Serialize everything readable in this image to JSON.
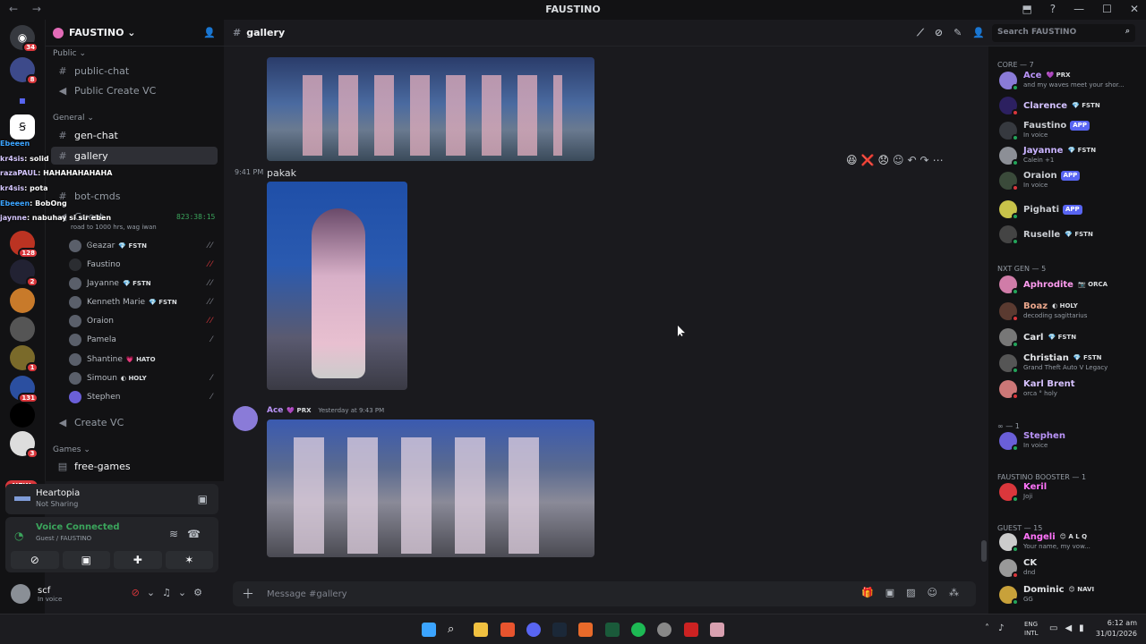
{
  "window": {
    "title": "FAUSTINO",
    "nav": "←  →",
    "controls": [
      "⬒",
      "?",
      "—",
      "☐",
      "✕"
    ]
  },
  "guilds": [
    {
      "badge": "34"
    },
    {
      "badge": "8"
    },
    {
      "badge": ""
    },
    {
      "badge": ""
    },
    {
      "badge": "128"
    },
    {
      "badge": "2"
    },
    {
      "badge": ""
    },
    {
      "badge": ""
    },
    {
      "badge": "1"
    },
    {
      "badge": "131"
    },
    {
      "badge": ""
    },
    {
      "badge": "3"
    }
  ],
  "new_label": "NEW",
  "server": {
    "name": "FAUSTINO ⌄"
  },
  "categories": {
    "public": "Public ⌄",
    "general": "General ⌄",
    "games": "Games ⌄"
  },
  "channels": {
    "public_chat": "public-chat",
    "public_vc": "Public Create VC",
    "gen_chat": "gen-chat",
    "gallery": "gallery",
    "bot_cmds": "bot-cmds",
    "guest": "Guest",
    "guest_status": "road to 1000 hrs, wag iwan",
    "create_vc": "Create VC",
    "free_games": "free-games"
  },
  "voice_timer": "823:38:15",
  "voice_users": [
    {
      "name": "Ꮆeazar",
      "tag": "💎 FSTN"
    },
    {
      "name": "Faustino",
      "tag": ""
    },
    {
      "name": "Jayanne",
      "tag": "💎 FSTN"
    },
    {
      "name": "Kenneth Marie",
      "tag": "💎 FSTN"
    },
    {
      "name": "Oraion",
      "tag": ""
    },
    {
      "name": "Pamela",
      "tag": ""
    },
    {
      "name": "Shantine",
      "tag": "💗 HATO"
    },
    {
      "name": "Simoun",
      "tag": "◐ HOLY"
    },
    {
      "name": "Stephen",
      "tag": ""
    }
  ],
  "overlay_chat": [
    {
      "user": "Ebeeen",
      "text": ""
    },
    {
      "user": "kr4sis",
      "text": ": solid"
    },
    {
      "user": "razaPAUL",
      "text": ": HAHAHAHAHAHA"
    },
    {
      "user": "kr4sis",
      "text": ": pota"
    },
    {
      "user": "Ebeeen",
      "text": ": BobOng"
    },
    {
      "user": "jaynne",
      "text": ": nabuhay si sir eben"
    }
  ],
  "activity": {
    "title": "Heartopia",
    "sub": "Not Sharing"
  },
  "voice": {
    "status": "Voice Connected",
    "channel": "Guest / FAUSTINO"
  },
  "user": {
    "name": "scf",
    "status": "In voice"
  },
  "channel_header": {
    "name": "gallery",
    "search_placeholder": "Search FAUSTINO"
  },
  "messages": [
    {
      "time": "9:41 PM",
      "text": "pakak"
    },
    {
      "author": "Ace",
      "tag": "💜 PRX",
      "timestamp": "Yesterday at 9:43 PM"
    }
  ],
  "reactions": "😆❌😞",
  "composer_placeholder": "Message #gallery",
  "member_groups": [
    {
      "title": "CORE — 7",
      "members": [
        {
          "name": "Ace",
          "tag": "💜 PRX",
          "sub": "and my waves meet your shor...",
          "color": "#b993f7",
          "av": "#8a7bd8"
        },
        {
          "name": "Clarence",
          "tag": "💎 FSTN",
          "sub": "",
          "color": "#d3c1ff",
          "av": "#2c2060"
        },
        {
          "name": "Faustino",
          "tag": "APP",
          "sub": "In voice",
          "color": "#c9ccd1",
          "av": "#36393f"
        },
        {
          "name": "Jayanne",
          "tag": "💎 FSTN",
          "sub": "Calein +1",
          "color": "#c9b3ff",
          "av": "#8c8f96"
        },
        {
          "name": "Oraion",
          "tag": "APP",
          "sub": "In voice",
          "color": "#c9ccd1",
          "av": "#3a4a3a"
        },
        {
          "name": "Pighati",
          "tag": "APP",
          "sub": "",
          "color": "#c9ccd1",
          "av": "#c8c34a"
        },
        {
          "name": "Ruselle",
          "tag": "💎 FSTN",
          "sub": "",
          "color": "#c9ccd1",
          "av": "#444"
        }
      ]
    },
    {
      "title": "NXT GEN — 5",
      "members": [
        {
          "name": "Aphrodite",
          "tag": "📷 ORCA",
          "sub": "",
          "color": "#ff9cf0",
          "av": "#d07ca8"
        },
        {
          "name": "Boaz",
          "tag": "◐ HOLY",
          "sub": "decoding sagittarius",
          "color": "#e9a58a",
          "av": "#5a3a30"
        },
        {
          "name": "Carl",
          "tag": "💎 FSTN",
          "sub": "",
          "color": "#e3e5e8",
          "av": "#777"
        },
        {
          "name": "Christian",
          "tag": "💎 FSTN",
          "sub": "Grand Theft Auto V Legacy",
          "color": "#e3e5e8",
          "av": "#555"
        },
        {
          "name": "Karl Brent",
          "tag": "",
          "sub": "orca ° holy",
          "color": "#d7c2ff",
          "av": "#c77"
        }
      ]
    },
    {
      "title": "∞ — 1",
      "members": [
        {
          "name": "Stephen",
          "tag": "",
          "sub": "In voice",
          "color": "#b993f7",
          "av": "#6a5fd8"
        }
      ]
    },
    {
      "title": "Faustino Booster — 1",
      "members": [
        {
          "name": "Keril",
          "tag": "",
          "sub": "Joji",
          "color": "#ff73fa",
          "av": "#da373c"
        }
      ]
    },
    {
      "title": "Guest — 15",
      "members": [
        {
          "name": "Angeli",
          "tag": "😊 A L Q",
          "sub": "Your name, my vow...",
          "color": "#ff73fa",
          "av": "#ccc"
        },
        {
          "name": "CK",
          "tag": "",
          "sub": "dnd",
          "color": "#e3e5e8",
          "av": "#999"
        },
        {
          "name": "Dominic",
          "tag": "😊 NAVI",
          "sub": "GG",
          "color": "#e3e5e8",
          "av": "#c8a13a"
        }
      ]
    }
  ],
  "taskbar": {
    "lang1": "ENG",
    "lang2": "INTL",
    "time": "6:12 am",
    "date": "31/01/2026"
  },
  "colors": {
    "accent": "#5865f2",
    "online": "#23a55a",
    "dnd": "#da373c",
    "idle": "#f0b232"
  }
}
